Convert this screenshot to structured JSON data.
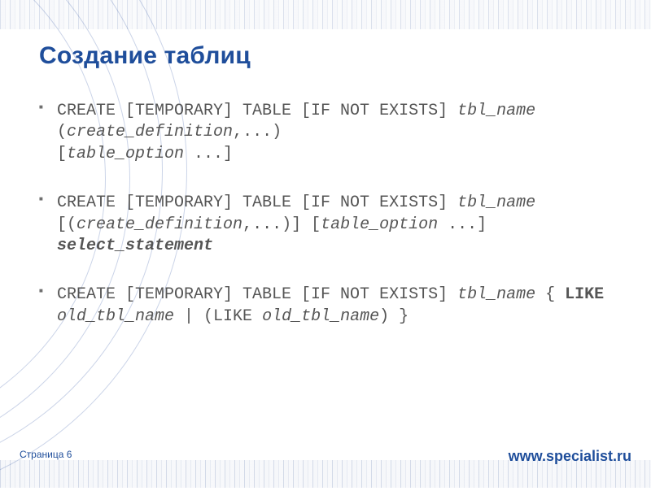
{
  "title": "Создание таблиц",
  "bullets": [
    {
      "segments": [
        {
          "t": "CREATE [TEMPORARY] TABLE [IF NOT EXISTS] "
        },
        {
          "t": "tbl_name",
          "cls": "it"
        },
        {
          "t": "\n("
        },
        {
          "t": "create_definition",
          "cls": "it"
        },
        {
          "t": ",...)\n["
        },
        {
          "t": "table_option",
          "cls": "it"
        },
        {
          "t": " ...]"
        }
      ]
    },
    {
      "segments": [
        {
          "t": "CREATE [TEMPORARY] TABLE [IF NOT EXISTS] "
        },
        {
          "t": "tbl_name",
          "cls": "it"
        },
        {
          "t": "\n[("
        },
        {
          "t": "create_definition",
          "cls": "it"
        },
        {
          "t": ",...)] ["
        },
        {
          "t": "table_option",
          "cls": "it"
        },
        {
          "t": " ...] "
        },
        {
          "t": "select_statement",
          "cls": "bi"
        }
      ]
    },
    {
      "segments": [
        {
          "t": "CREATE [TEMPORARY] TABLE [IF NOT EXISTS] "
        },
        {
          "t": "tbl_name",
          "cls": "it"
        },
        {
          "t": " { "
        },
        {
          "t": "LIKE",
          "cls": "b"
        },
        {
          "t": " "
        },
        {
          "t": "old_tbl_name",
          "cls": "it"
        },
        {
          "t": " | (LIKE "
        },
        {
          "t": "old_tbl_name",
          "cls": "it"
        },
        {
          "t": ") }"
        }
      ]
    }
  ],
  "footer": {
    "page_label": "Страница ",
    "page_bullet": "",
    "page_num": "6",
    "site": "www.specialist.ru"
  }
}
